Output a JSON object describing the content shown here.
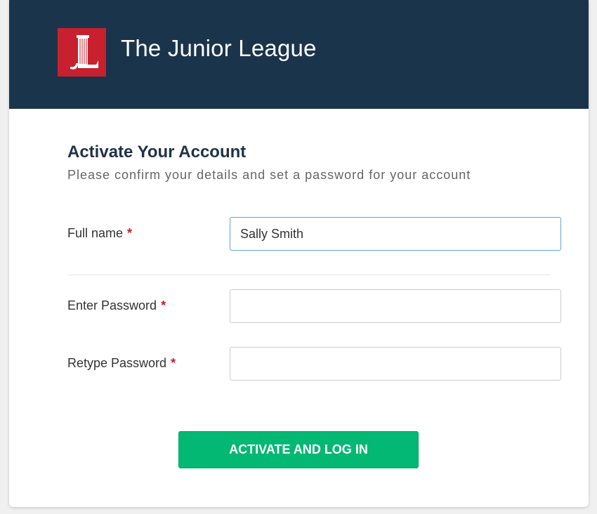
{
  "header": {
    "org_name": "The Junior League",
    "logo_icon": "junior-league-logo",
    "background_color": "#1a344b",
    "logo_color": "#c8202e"
  },
  "form": {
    "title": "Activate Your Account",
    "subtitle": "Please confirm your details and set a password for your account",
    "required_marker": "*",
    "fields": {
      "full_name": {
        "label": "Full name",
        "value": "Sally Smith",
        "placeholder": ""
      },
      "password": {
        "label": "Enter Password",
        "value": "",
        "placeholder": ""
      },
      "retype_password": {
        "label": "Retype Password",
        "value": "",
        "placeholder": ""
      }
    },
    "submit_label": "ACTIVATE AND LOG IN",
    "submit_color": "#02b872"
  }
}
